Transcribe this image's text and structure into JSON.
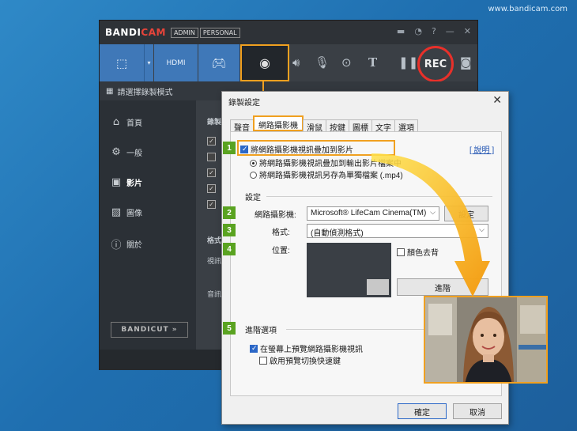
{
  "watermark": "www.bandicam.com",
  "bandicam": {
    "logo_a": "BANDI",
    "logo_b": "CAM",
    "badge_admin": "ADMIN",
    "badge_personal": "PERSONAL",
    "subbar_title": "請選擇錄製模式",
    "rec_label": "REC",
    "sidebar": [
      {
        "icon": "home-icon",
        "label": "首頁"
      },
      {
        "icon": "gear-icon",
        "label": "一般"
      },
      {
        "icon": "video-icon",
        "label": "影片"
      },
      {
        "icon": "image-icon",
        "label": "圖像"
      },
      {
        "icon": "info-icon",
        "label": "關於"
      }
    ],
    "bandicut_label": "BANDICUT",
    "content_labels": {
      "record": "錄製",
      "format": "格式",
      "video": "視訊",
      "audio": "音訊"
    }
  },
  "dialog": {
    "title": "錄製設定",
    "close": "✕",
    "tabs": [
      "聲音",
      "網路攝影機",
      "滑鼠",
      "按鍵",
      "圖標",
      "文字",
      "選項"
    ],
    "active_tab": 1,
    "overlay_checkbox": "將網路攝影機視訊疊加到影片",
    "help_link": "[ 說明 ]",
    "radio_overlay": "將網路攝影機視訊疊加到輸出影片檔案中",
    "radio_separate": "將網路攝影機視訊另存為單獨檔案 (.mp4)",
    "settings_group": "設定",
    "webcam_label": "網路攝影機:",
    "webcam_value": "Microsoft® LifeCam Cinema(TM)",
    "settings_button": "設定",
    "format_label": "格式:",
    "format_value": "(自動偵測格式)",
    "position_label": "位置:",
    "chroma_checkbox": "顏色去背",
    "advanced_button": "進階",
    "advanced_group": "進階選項",
    "preview_checkbox": "在螢幕上預覽網路攝影機視訊",
    "hotkey_checkbox": "啟用預覽切換快速鍵",
    "ok_button": "確定",
    "cancel_button": "取消",
    "steps": [
      "1",
      "2",
      "3",
      "4",
      "5"
    ]
  },
  "colors": {
    "accent_orange": "#f0a020",
    "step_green": "#5aa321",
    "rec_red": "#e8302a",
    "toolbar_blue": "#3f78b8"
  }
}
